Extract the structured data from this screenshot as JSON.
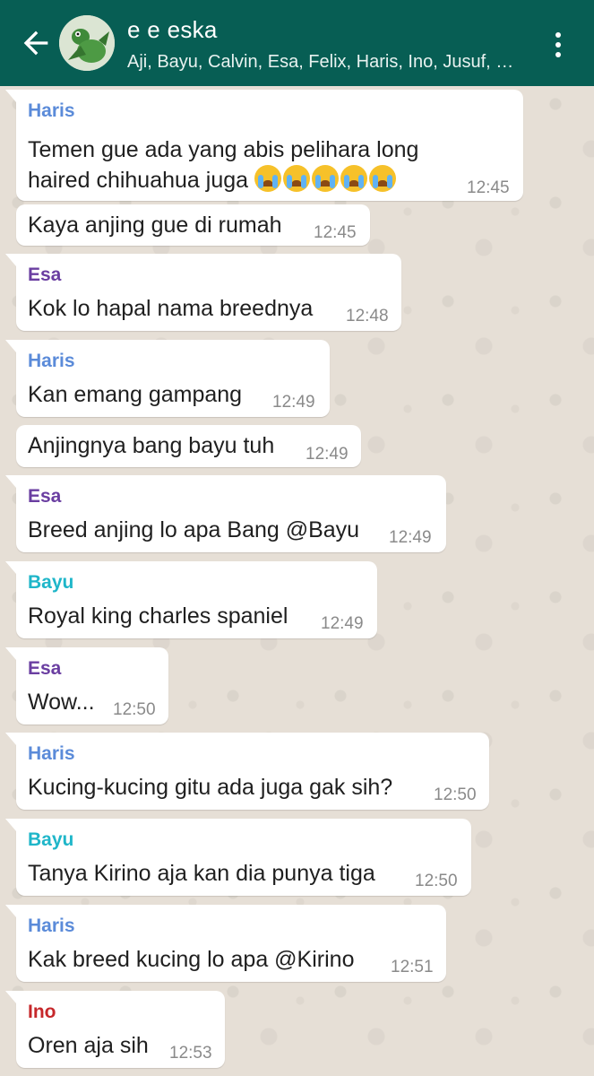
{
  "header": {
    "title": "e e eska",
    "subtitle": "Aji, Bayu, Calvin, Esa, Felix, Haris, Ino, Jusuf, Kirino",
    "back_icon": "arrow-left-icon",
    "menu_icon": "more-vertical-icon"
  },
  "colors": {
    "header_bg": "#075e54",
    "haris": "#5b8bd9",
    "esa": "#6a3ea1",
    "bayu": "#1fb6c9",
    "ino": "#c6282b"
  },
  "messages": [
    {
      "sender": "Haris",
      "line1": "Temen gue ada yang abis pelihara long",
      "line2": "haired chihuahua juga",
      "emoji": "loudly-crying-face x5",
      "time": "12:45"
    },
    {
      "sender": "",
      "text": "Kaya anjing gue di rumah",
      "time": "12:45"
    },
    {
      "sender": "Esa",
      "text": "Kok lo hapal nama breednya",
      "time": "12:48"
    },
    {
      "sender": "Haris",
      "text": "Kan emang gampang",
      "time": "12:49"
    },
    {
      "sender": "",
      "text": "Anjingnya bang bayu tuh",
      "time": "12:49"
    },
    {
      "sender": "Esa",
      "text": "Breed anjing lo apa Bang @Bayu",
      "time": "12:49"
    },
    {
      "sender": "Bayu",
      "text": "Royal king charles spaniel",
      "time": "12:49"
    },
    {
      "sender": "Esa",
      "text": "Wow...",
      "time": "12:50"
    },
    {
      "sender": "Haris",
      "text": "Kucing-kucing gitu ada juga gak sih?",
      "time": "12:50"
    },
    {
      "sender": "Bayu",
      "text": "Tanya Kirino aja kan dia punya tiga",
      "time": "12:50"
    },
    {
      "sender": "Haris",
      "text": "Kak breed kucing lo apa @Kirino",
      "time": "12:51"
    },
    {
      "sender": "Ino",
      "text": "Oren aja sih",
      "time": "12:53"
    }
  ]
}
